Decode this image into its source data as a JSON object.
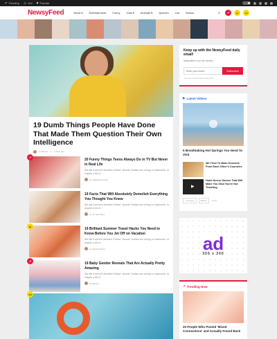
{
  "topbar": {
    "tags": [
      {
        "icon": "trending-icon",
        "label": "Trending"
      },
      {
        "icon": "fire-icon",
        "label": "Hot"
      },
      {
        "icon": "heart-icon",
        "label": "Popular"
      }
    ]
  },
  "header": {
    "logo": "NewsyFeed",
    "nav": [
      "News ▾",
      "Entertainment",
      "Funny",
      "Cats ▾",
      "Animals ▾",
      "Quizzes",
      "List",
      "Videos"
    ],
    "icons": [
      "search-icon",
      "trending-icon",
      "hot-icon",
      "wtf-icon"
    ]
  },
  "hero": {
    "title": "19 Dumb Things People Have Done That Made Them Question Their Own Intelligence",
    "author": "by Bimber",
    "date": "3 days ago"
  },
  "list": [
    {
      "title": "20 Funny Things Teens Always Do in TV But Never in Real Life",
      "excerpt": "We did it weren't decided if these \"Aussie\" bodies are creepy or awesome, or maybe a bit of...",
      "author": "by Abasalla Kamadi",
      "badge": "↗",
      "badge_color": "#e5193f"
    },
    {
      "title": "19 Facts That Will Absolutely Demolish Everything You Thought You Knew",
      "excerpt": "We did it weren't decided if these \"Aussie\" bodies are creepy or awesome, or maybe a bit of...",
      "author": "by Jennifer Bean",
      "badge": "",
      "badge_color": ""
    },
    {
      "title": "19 Brilliant Summer Travel Hacks You Need to Know Before You Jet Off on Vacation",
      "excerpt": "We did it weren't decided if these \"Aussie\" bodies are creepy or awesome, or maybe a bit of...",
      "author": "by Rachel Ribson",
      "badge": "lol",
      "badge_color": "#f5d800"
    },
    {
      "title": "19 Baby Gender Reveals That Are Actually Pretty Amazing",
      "excerpt": "We did it weren't decided if these \"Aussie\" bodies are creepy or awesome, or maybe a bit of...",
      "author": "by Bimber",
      "badge": "↗",
      "badge_color": "#e5193f"
    }
  ],
  "last_badge": {
    "label": "wtf",
    "color": "#f5d800"
  },
  "newsletter": {
    "title": "Keep up with the NewsyFeed daily email!",
    "subtitle": "Subscribe to our fun stories",
    "placeholder": "Enter your email...",
    "button": "Subscribe",
    "note": "You can unsubscribe at any time"
  },
  "latest_videos": {
    "heading": "Latest Videos",
    "main_title": "5 Breathtaking Hot Springs You Need To Visit",
    "items": [
      {
        "title": "We Tried To Make Desserts From Each Other's Countries"
      },
      {
        "title": "Hotel Horror Stories That Will Make You Glad You're Not Traveling"
      }
    ],
    "pager": {
      "prev": "‹ Previous",
      "next": "NEXT ›",
      "count": "1 of 6"
    }
  },
  "ad": {
    "big": "ad",
    "size": "350 x 300"
  },
  "trending": {
    "heading": "Trending Now",
    "badge": "↗",
    "title": "20 People Who Posted 'Mixed Connections' and Actually Found Back"
  },
  "colors": {
    "brand": "#e5193f",
    "accent_blue": "#1d6fd8",
    "badge_yellow": "#f5d800"
  }
}
